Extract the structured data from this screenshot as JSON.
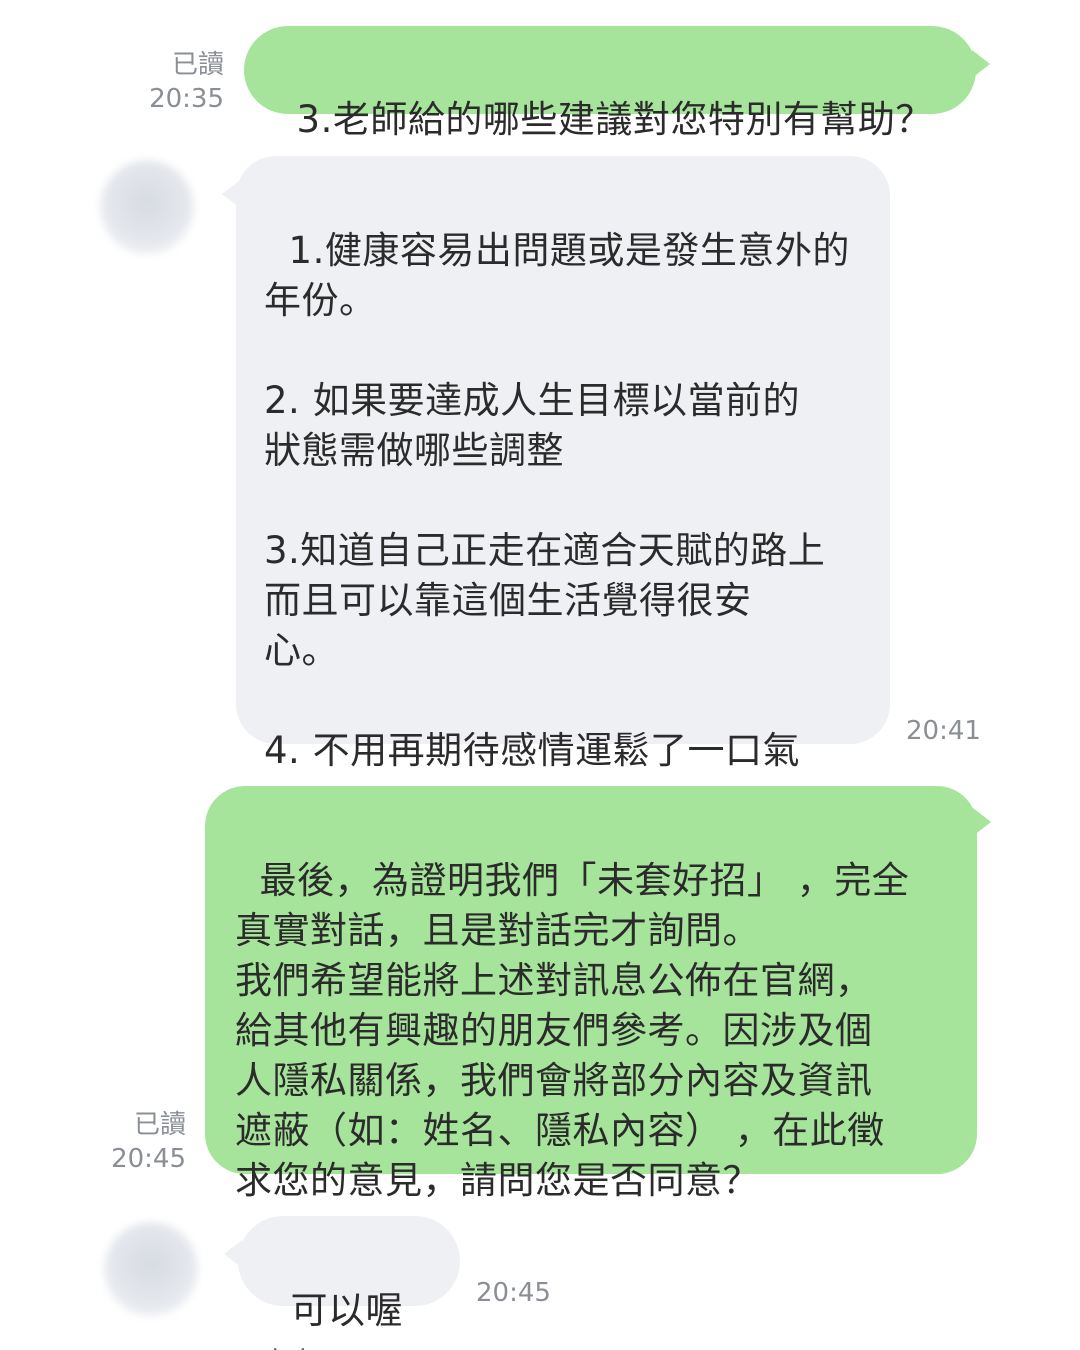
{
  "messages": [
    {
      "sender": "me",
      "read_label": "已讀",
      "time": "20:35",
      "text": "3.老師給的哪些建議對您特別有幫助？"
    },
    {
      "sender": "other",
      "time": "20:41",
      "text": "1.健康容易出問題或是發生意外的\n年份。\n\n2. 如果要達成人生目標以當前的\n狀態需做哪些調整\n\n3.知道自己正走在適合天賦的路上\n而且可以靠這個生活覺得很安\n心。\n\n4. 不用再期待感情運鬆了一口氣"
    },
    {
      "sender": "me",
      "read_label": "已讀",
      "time": "20:45",
      "text": "最後，為證明我們「未套好招」 ，完全\n真實對話，且是對話完才詢問。\n我們希望能將上述對訊息公佈在官網，\n給其他有興趣的朋友們參考。因涉及個\n人隱私關係，我們會將部分內容及資訊\n遮蔽（如：姓名、隱私內容） ，在此徵\n求您的意見，請問您是否同意？"
    },
    {
      "sender": "other",
      "time": "20:45",
      "text": "可以喔",
      "emoji": "cat-face-emoji"
    }
  ],
  "colors": {
    "outgoing_bubble": "#a6e39b",
    "incoming_bubble": "#eef0f3",
    "meta_text": "#8a8f96",
    "body_text": "#2b2b2b"
  }
}
